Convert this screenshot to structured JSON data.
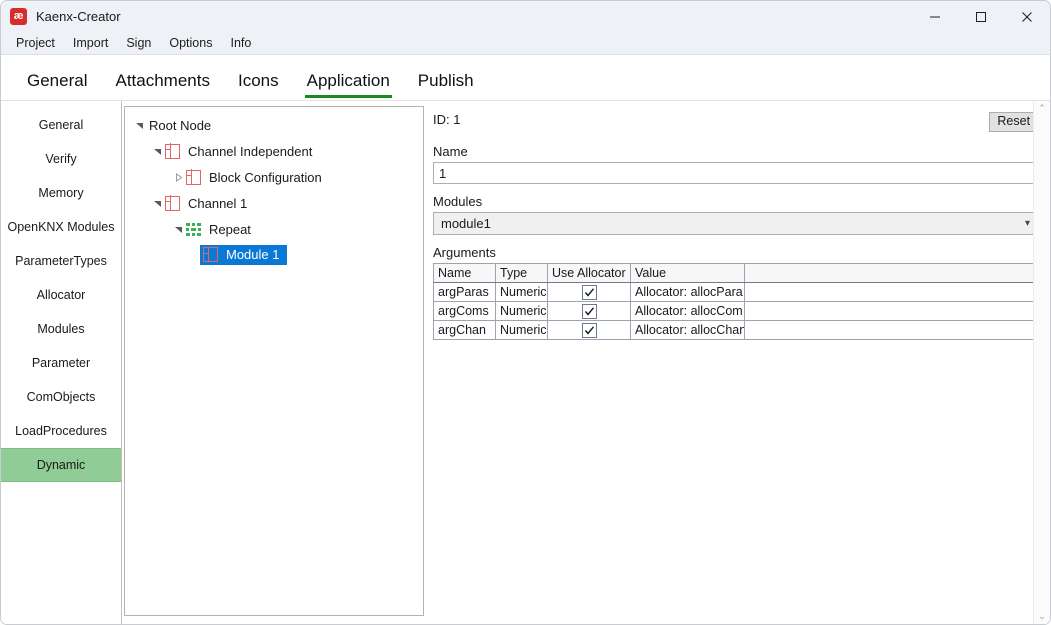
{
  "window": {
    "title": "Kaenx-Creator",
    "icon": "ae-logo-icon",
    "minimize": "—",
    "maximize": "□",
    "close": "✕"
  },
  "menubar": {
    "items": [
      {
        "label": "Project"
      },
      {
        "label": "Import"
      },
      {
        "label": "Sign"
      },
      {
        "label": "Options"
      },
      {
        "label": "Info"
      }
    ]
  },
  "tabs": {
    "active": "Application",
    "items": [
      {
        "label": "General"
      },
      {
        "label": "Attachments"
      },
      {
        "label": "Icons"
      },
      {
        "label": "Application"
      },
      {
        "label": "Publish"
      }
    ],
    "accent_color": "#1a8a1f"
  },
  "sidebar": {
    "selected": "Dynamic",
    "selected_color": "#8fcc96",
    "items": [
      {
        "label": "General"
      },
      {
        "label": "Verify"
      },
      {
        "label": "Memory"
      },
      {
        "label": "OpenKNX Modules"
      },
      {
        "label": "ParameterTypes"
      },
      {
        "label": "Allocator"
      },
      {
        "label": "Modules"
      },
      {
        "label": "Parameter"
      },
      {
        "label": "ComObjects"
      },
      {
        "label": "LoadProcedures"
      },
      {
        "label": "Dynamic"
      }
    ]
  },
  "tree": {
    "selected_color": "#0a79d6",
    "nodes": [
      {
        "label": "Root Node",
        "indent": 0,
        "twisty": "expanded",
        "icon": "none",
        "selected": false
      },
      {
        "label": "Channel Independent",
        "indent": 1,
        "twisty": "expanded",
        "icon": "channel-icon",
        "selected": false
      },
      {
        "label": "Block Configuration",
        "indent": 2,
        "twisty": "collapsed",
        "icon": "channel-icon",
        "selected": false
      },
      {
        "label": "Channel 1",
        "indent": 1,
        "twisty": "expanded",
        "icon": "channel-icon",
        "selected": false
      },
      {
        "label": "Repeat",
        "indent": 2,
        "twisty": "expanded",
        "icon": "repeat-icon",
        "selected": false
      },
      {
        "label": "Module 1",
        "indent": 3,
        "twisty": "none",
        "icon": "channel-icon",
        "selected": true
      }
    ]
  },
  "detail": {
    "id_label": "ID: 1",
    "reset_label": "Reset",
    "name_label": "Name",
    "name_value": "1",
    "modules_label": "Modules",
    "modules_value": "module1",
    "arguments_label": "Arguments",
    "table": {
      "headers": [
        "Name",
        "Type",
        "Use Allocator",
        "Value",
        ""
      ],
      "rows": [
        {
          "name": "argParas",
          "type": "Numeric",
          "use_allocator": true,
          "value": "Allocator: allocPara",
          "extra": ""
        },
        {
          "name": "argComs",
          "type": "Numeric",
          "use_allocator": true,
          "value": "Allocator: allocCom",
          "extra": ""
        },
        {
          "name": "argChan",
          "type": "Numeric",
          "use_allocator": true,
          "value": "Allocator: allocChan",
          "extra": ""
        }
      ]
    }
  },
  "scrollbar": {
    "up": "⌃",
    "down": "⌄"
  }
}
